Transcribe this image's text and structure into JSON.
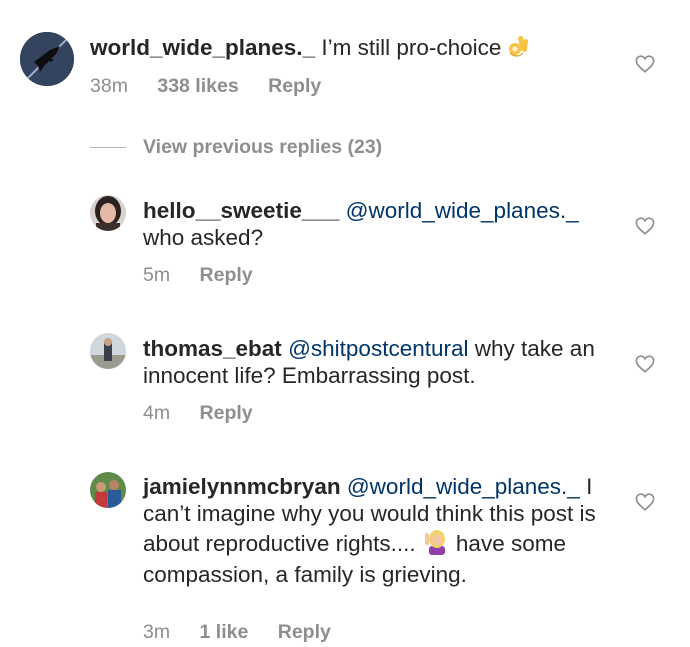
{
  "comments": [
    {
      "username": "world_wide_planes._",
      "mention": "",
      "text": "I’m still pro-choice",
      "time": "38m",
      "likes": "338 likes",
      "reply": "Reply",
      "emoji_icon": "ok-hand-emoji-icon"
    },
    {
      "username": "hello__sweetie___",
      "mention": "@world_wide_planes._",
      "text": "who asked?",
      "time": "5m",
      "likes": "",
      "reply": "Reply"
    },
    {
      "username": "thomas_ebat",
      "mention": "@shitpostcentural",
      "text": "why take an innocent life?  Embarrassing post.",
      "time": "4m",
      "likes": "",
      "reply": "Reply"
    },
    {
      "username": "jamielynnmcbryan",
      "mention": "@world_wide_planes._",
      "text": "I can’t imagine why you would think this post is about reproductive rights....",
      "text_after_emoji": "have some compassion, a family is grieving.",
      "time": "3m",
      "likes": "1 like",
      "reply": "Reply",
      "emoji_icon": "woman-raising-hand-emoji-icon"
    }
  ],
  "view_previous": "View previous replies (23)",
  "colors": {
    "text": "#262626",
    "muted": "#8e8e8e",
    "mention": "#003569",
    "heart": "#8e8e8e"
  },
  "icons": [
    "heart-icon",
    "avatar"
  ]
}
